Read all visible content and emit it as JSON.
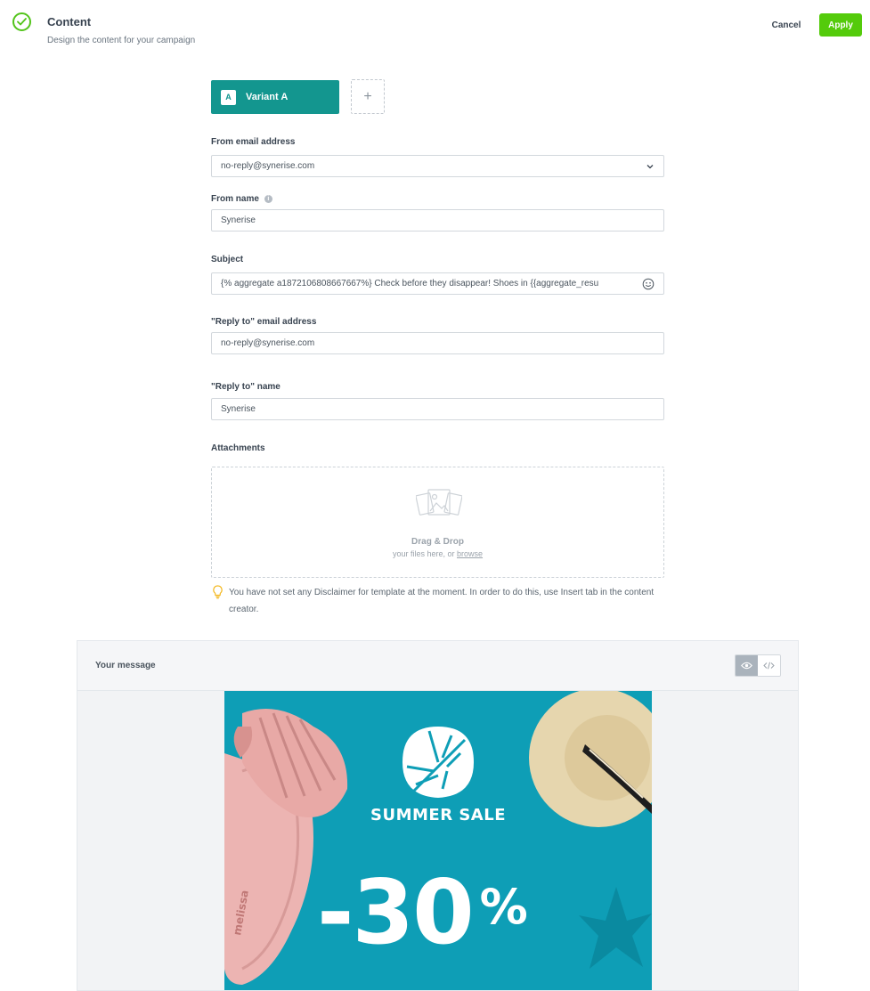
{
  "header": {
    "title": "Content",
    "subtitle": "Design the content for your campaign",
    "cancel_label": "Cancel",
    "apply_label": "Apply"
  },
  "variant": {
    "badge": "A",
    "label": "Variant A",
    "add_symbol": "+"
  },
  "form": {
    "from_email": {
      "label": "From email address",
      "value": "no-reply@synerise.com"
    },
    "from_name": {
      "label": "From name",
      "value": "Synerise"
    },
    "subject": {
      "label": "Subject",
      "value": "{% aggregate a1872106808667667%} Check before they disappear! Shoes in {{aggregate_resu"
    },
    "reply_to_email": {
      "label": "\"Reply to\" email address",
      "value": "no-reply@synerise.com"
    },
    "reply_to_name": {
      "label": "\"Reply to\" name",
      "value": "Synerise"
    },
    "attachments": {
      "label": "Attachments",
      "drop_title": "Drag & Drop",
      "drop_sub": "your files here, or",
      "browse_link": "browse"
    },
    "notice": "You have not set any Disclaimer for template at the moment. In order to do this, use Insert tab in the content creator."
  },
  "message": {
    "title": "Your message",
    "view_preview_icon": "eye-icon",
    "view_code_icon": "code-icon",
    "banner": {
      "headline": "SUMMER SALE",
      "discount": "-30",
      "percent": "%",
      "product_brand": "melissa",
      "background_color": "#0e9eb6"
    }
  },
  "colors": {
    "accent_green": "#54cb0b",
    "variant_teal": "#13968f",
    "check_green": "#52c41a"
  }
}
